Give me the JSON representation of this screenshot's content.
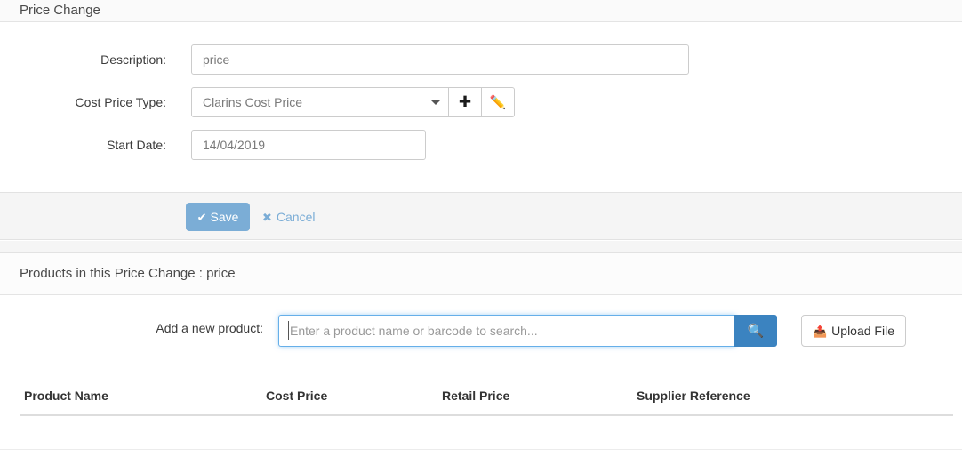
{
  "panel": {
    "title": "Price Change"
  },
  "form": {
    "fields": [
      {
        "label": "Description:",
        "value": "price",
        "type": "text"
      },
      {
        "label": "Cost Price Type:",
        "value": "Clarins Cost Price",
        "type": "select",
        "add_icon": "plus-icon",
        "add_glyph": "✚",
        "edit_icon": "pencil-icon",
        "edit_glyph": "✏️"
      },
      {
        "label": "Start Date:",
        "value": "14/04/2019",
        "type": "date"
      }
    ]
  },
  "footer": {
    "save_label": "Save",
    "save_icon": "check-icon",
    "save_glyph": "✔",
    "save_color": "#7badd6",
    "cancel_label": "Cancel",
    "cancel_icon": "close-icon",
    "cancel_glyph": "✖",
    "cancel_color": "#7badd6"
  },
  "products": {
    "heading": "Products in this Price Change : price",
    "search": {
      "label": "Add a new product:",
      "value": "",
      "placeholder": "Enter a product name or barcode to search...",
      "button_icon": "search-icon",
      "button_glyph": "🔍",
      "button_color": "#3b83c0"
    },
    "upload": {
      "label": "Upload File",
      "icon": "upload-icon",
      "glyph": "📤"
    },
    "table": {
      "columns": [
        "Product Name",
        "Cost Price",
        "Retail Price",
        "Supplier Reference"
      ],
      "rows": []
    }
  }
}
